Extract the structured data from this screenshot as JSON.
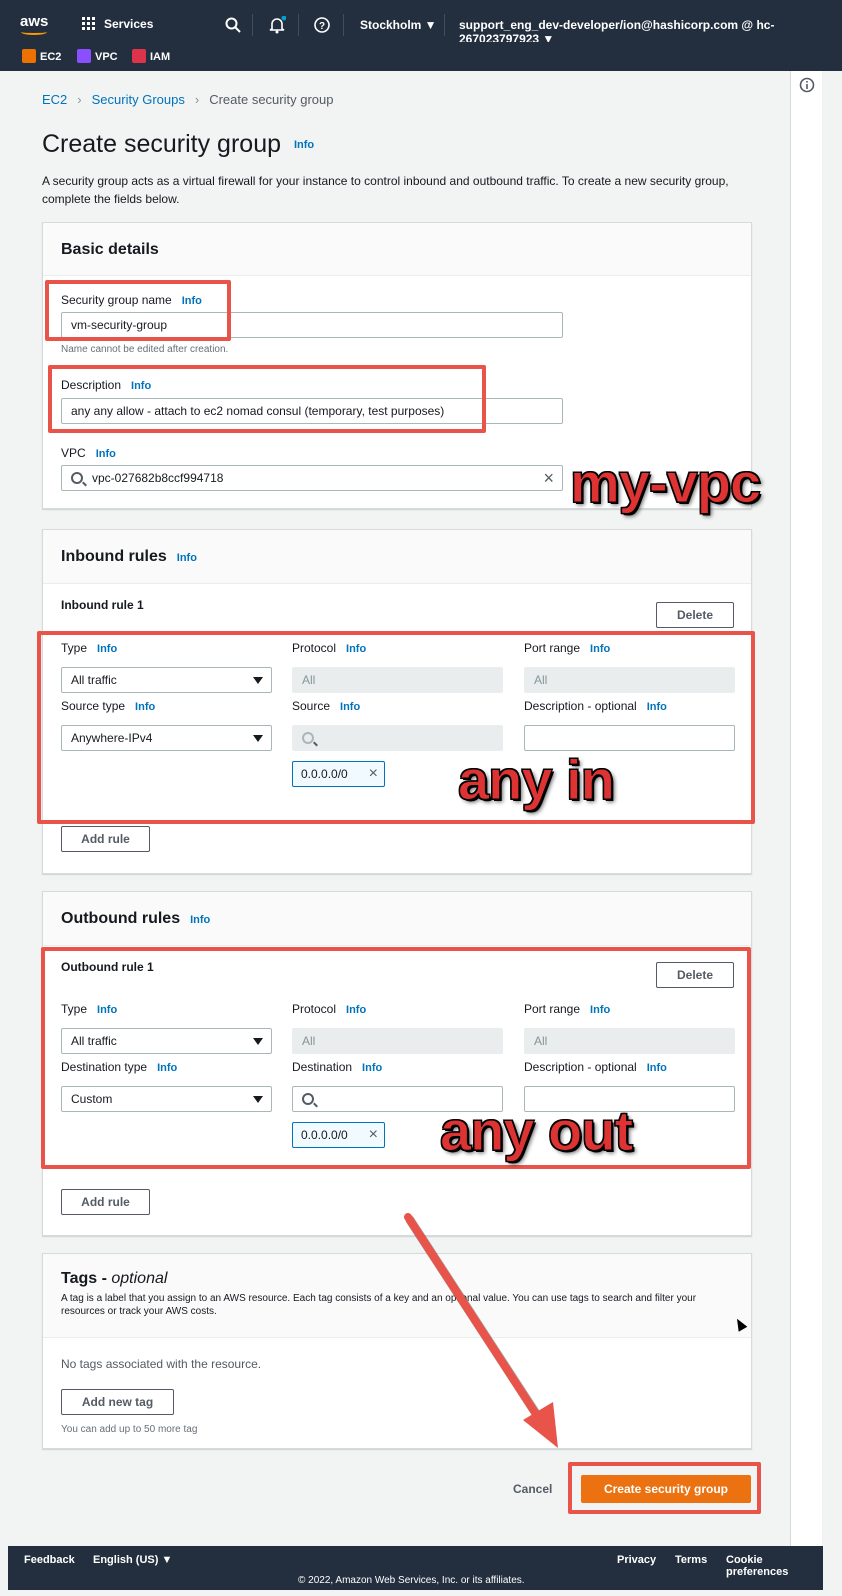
{
  "nav": {
    "logo": "aws",
    "services_label": "Services",
    "region": "Stockholm ▼",
    "account": "support_eng_dev-developer/ion@hashicorp.com @ hc-267023797923 ▼",
    "favorites": [
      {
        "label": "EC2",
        "color": "#ed7100"
      },
      {
        "label": "VPC",
        "color": "#8c4fff"
      },
      {
        "label": "IAM",
        "color": "#dd344c"
      }
    ]
  },
  "breadcrumb": {
    "ec2": "EC2",
    "security_groups": "Security Groups",
    "current": "Create security group"
  },
  "page": {
    "title": "Create security group",
    "title_info": "Info",
    "description": "A security group acts as a virtual firewall for your instance to control inbound and outbound traffic. To create a new security group, complete the fields below."
  },
  "basic": {
    "heading": "Basic details",
    "name_label": "Security group name",
    "name_value": "vm-security-group",
    "name_hint": "Name cannot be edited after creation.",
    "desc_label": "Description",
    "desc_value": "any any allow - attach to ec2 nomad consul (temporary, test purposes)",
    "vpc_label": "VPC",
    "vpc_value": "vpc-027682b8ccf994718",
    "info": "Info"
  },
  "inbound": {
    "heading": "Inbound rules",
    "rule_title": "Inbound rule 1",
    "delete": "Delete",
    "type_label": "Type",
    "type_value": "All traffic",
    "protocol_label": "Protocol",
    "protocol_value": "All",
    "port_label": "Port range",
    "port_value": "All",
    "source_type_label": "Source type",
    "source_type_value": "Anywhere-IPv4",
    "source_label": "Source",
    "desc_label": "Description - optional",
    "token": "0.0.0.0/0",
    "add_rule": "Add rule",
    "info": "Info"
  },
  "outbound": {
    "heading": "Outbound rules",
    "rule_title": "Outbound rule 1",
    "delete": "Delete",
    "type_label": "Type",
    "type_value": "All traffic",
    "protocol_label": "Protocol",
    "protocol_value": "All",
    "port_label": "Port range",
    "port_value": "All",
    "dest_type_label": "Destination type",
    "dest_type_value": "Custom",
    "dest_label": "Destination",
    "desc_label": "Description - optional",
    "token": "0.0.0.0/0",
    "add_rule": "Add rule",
    "info": "Info"
  },
  "tags": {
    "heading": "Tags - ",
    "heading_optional": "optional",
    "description": "A tag is a label that you assign to an AWS resource. Each tag consists of a key and an optional value. You can use tags to search and filter your resources or track your AWS costs.",
    "empty": "No tags associated with the resource.",
    "add_tag": "Add new tag",
    "limit": "You can add up to 50 more tag"
  },
  "actions": {
    "cancel": "Cancel",
    "create": "Create security group"
  },
  "annotations": {
    "vpc": "my-vpc",
    "in": "any in",
    "out": "any out"
  },
  "footer": {
    "feedback": "Feedback",
    "language": "English (US) ▼",
    "privacy": "Privacy",
    "terms": "Terms",
    "cookies": "Cookie preferences",
    "copyright": "© 2022, Amazon Web Services, Inc. or its affiliates."
  }
}
